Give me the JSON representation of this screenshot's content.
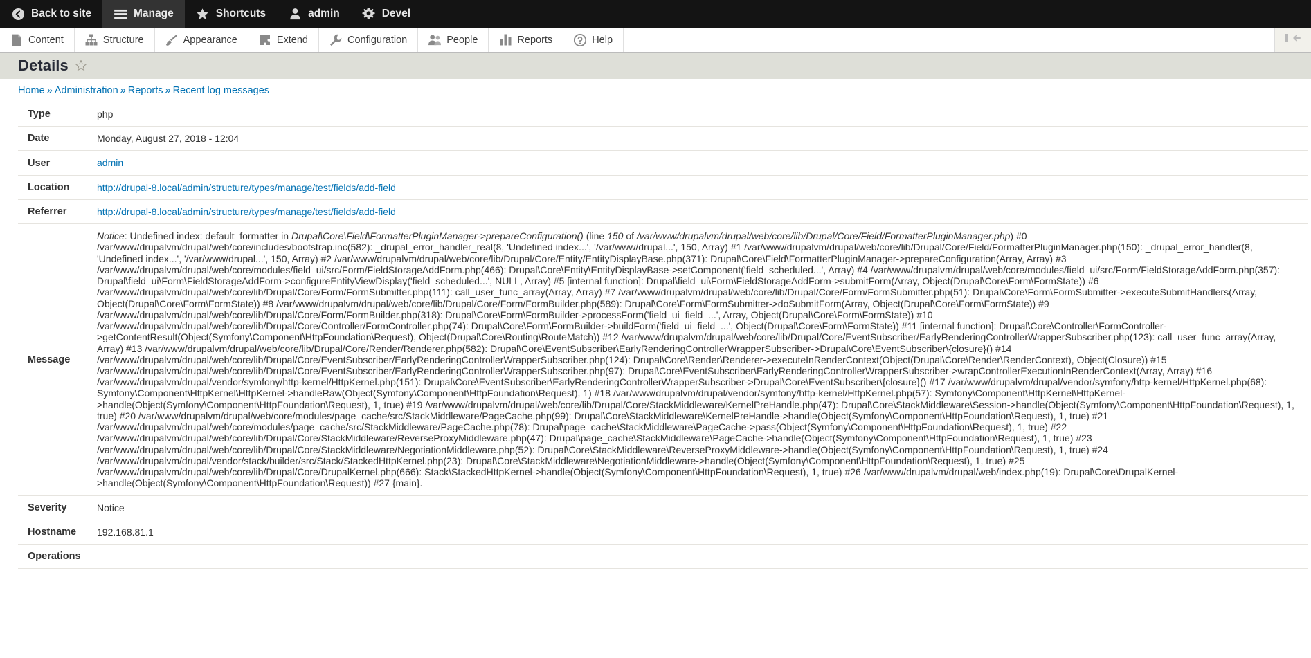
{
  "toolbar": {
    "items": [
      {
        "label": "Back to site",
        "icon": "back-arrow-icon",
        "active": false
      },
      {
        "label": "Manage",
        "icon": "hamburger-icon",
        "active": true
      },
      {
        "label": "Shortcuts",
        "icon": "star-icon",
        "active": false
      },
      {
        "label": "admin",
        "icon": "user-icon",
        "active": false
      },
      {
        "label": "Devel",
        "icon": "gear-icon",
        "active": false
      }
    ]
  },
  "admin_menu": {
    "items": [
      {
        "label": "Content",
        "icon": "file-icon"
      },
      {
        "label": "Structure",
        "icon": "sitemap-icon"
      },
      {
        "label": "Appearance",
        "icon": "paintbrush-icon"
      },
      {
        "label": "Extend",
        "icon": "puzzle-icon"
      },
      {
        "label": "Configuration",
        "icon": "wrench-icon"
      },
      {
        "label": "People",
        "icon": "people-icon"
      },
      {
        "label": "Reports",
        "icon": "bar-chart-icon"
      },
      {
        "label": "Help",
        "icon": "question-circle-icon"
      }
    ],
    "orientation_toggle_icon": "vertical-orientation-toggle-icon"
  },
  "page": {
    "title": "Details",
    "shortcut_star_icon": "star-outline-icon"
  },
  "breadcrumb": {
    "separator": "»",
    "items": [
      "Home",
      "Administration",
      "Reports",
      "Recent log messages"
    ]
  },
  "details": {
    "rows": [
      {
        "label": "Type",
        "value": "php",
        "link": false
      },
      {
        "label": "Date",
        "value": "Monday, August 27, 2018 - 12:04",
        "link": false
      },
      {
        "label": "User",
        "value": "admin",
        "link": true
      },
      {
        "label": "Location",
        "value": "http://drupal-8.local/admin/structure/types/manage/test/fields/add-field",
        "link": true
      },
      {
        "label": "Referrer",
        "value": "http://drupal-8.local/admin/structure/types/manage/test/fields/add-field",
        "link": true
      }
    ],
    "message_label": "Message",
    "message_html": "<em>Notice</em>: Undefined index: default_formatter in <em>Drupal\\Core\\Field\\FormatterPluginManager-&gt;prepareConfiguration()</em> (line <em>150</em> of <em>/var/www/drupalvm/drupal/web/core/lib/Drupal/Core/Field/FormatterPluginManager.php</em>) #0 /var/www/drupalvm/drupal/web/core/includes/bootstrap.inc(582): _drupal_error_handler_real(8, 'Undefined index...', '/var/www/drupal...', 150, Array) #1 /var/www/drupalvm/drupal/web/core/lib/Drupal/Core/Field/FormatterPluginManager.php(150): _drupal_error_handler(8, 'Undefined index...', '/var/www/drupal...', 150, Array) #2 /var/www/drupalvm/drupal/web/core/lib/Drupal/Core/Entity/EntityDisplayBase.php(371): Drupal\\Core\\Field\\FormatterPluginManager-&gt;prepareConfiguration(Array, Array) #3 /var/www/drupalvm/drupal/web/core/modules/field_ui/src/Form/FieldStorageAddForm.php(466): Drupal\\Core\\Entity\\EntityDisplayBase-&gt;setComponent('field_scheduled...', Array) #4 /var/www/drupalvm/drupal/web/core/modules/field_ui/src/Form/FieldStorageAddForm.php(357): Drupal\\field_ui\\Form\\FieldStorageAddForm-&gt;configureEntityViewDisplay('field_scheduled...', NULL, Array) #5 [internal function]: Drupal\\field_ui\\Form\\FieldStorageAddForm-&gt;submitForm(Array, Object(Drupal\\Core\\Form\\FormState)) #6 /var/www/drupalvm/drupal/web/core/lib/Drupal/Core/Form/FormSubmitter.php(111): call_user_func_array(Array, Array) #7 /var/www/drupalvm/drupal/web/core/lib/Drupal/Core/Form/FormSubmitter.php(51): Drupal\\Core\\Form\\FormSubmitter-&gt;executeSubmitHandlers(Array, Object(Drupal\\Core\\Form\\FormState)) #8 /var/www/drupalvm/drupal/web/core/lib/Drupal/Core/Form/FormBuilder.php(589): Drupal\\Core\\Form\\FormSubmitter-&gt;doSubmitForm(Array, Object(Drupal\\Core\\Form\\FormState)) #9 /var/www/drupalvm/drupal/web/core/lib/Drupal/Core/Form/FormBuilder.php(318): Drupal\\Core\\Form\\FormBuilder-&gt;processForm('field_ui_field_...', Array, Object(Drupal\\Core\\Form\\FormState)) #10 /var/www/drupalvm/drupal/web/core/lib/Drupal/Core/Controller/FormController.php(74): Drupal\\Core\\Form\\FormBuilder-&gt;buildForm('field_ui_field_...', Object(Drupal\\Core\\Form\\FormState)) #11 [internal function]: Drupal\\Core\\Controller\\FormController-&gt;getContentResult(Object(Symfony\\Component\\HttpFoundation\\Request), Object(Drupal\\Core\\Routing\\RouteMatch)) #12 /var/www/drupalvm/drupal/web/core/lib/Drupal/Core/EventSubscriber/EarlyRenderingControllerWrapperSubscriber.php(123): call_user_func_array(Array, Array) #13 /var/www/drupalvm/drupal/web/core/lib/Drupal/Core/Render/Renderer.php(582): Drupal\\Core\\EventSubscriber\\EarlyRenderingControllerWrapperSubscriber-&gt;Drupal\\Core\\EventSubscriber\\{closure}() #14 /var/www/drupalvm/drupal/web/core/lib/Drupal/Core/EventSubscriber/EarlyRenderingControllerWrapperSubscriber.php(124): Drupal\\Core\\Render\\Renderer-&gt;executeInRenderContext(Object(Drupal\\Core\\Render\\RenderContext), Object(Closure)) #15 /var/www/drupalvm/drupal/web/core/lib/Drupal/Core/EventSubscriber/EarlyRenderingControllerWrapperSubscriber.php(97): Drupal\\Core\\EventSubscriber\\EarlyRenderingControllerWrapperSubscriber-&gt;wrapControllerExecutionInRenderContext(Array, Array) #16 /var/www/drupalvm/drupal/vendor/symfony/http-kernel/HttpKernel.php(151): Drupal\\Core\\EventSubscriber\\EarlyRenderingControllerWrapperSubscriber-&gt;Drupal\\Core\\EventSubscriber\\{closure}() #17 /var/www/drupalvm/drupal/vendor/symfony/http-kernel/HttpKernel.php(68): Symfony\\Component\\HttpKernel\\HttpKernel-&gt;handleRaw(Object(Symfony\\Component\\HttpFoundation\\Request), 1) #18 /var/www/drupalvm/drupal/vendor/symfony/http-kernel/HttpKernel.php(57): Symfony\\Component\\HttpKernel\\HttpKernel-&gt;handle(Object(Symfony\\Component\\HttpFoundation\\Request), 1, true) #19 /var/www/drupalvm/drupal/web/core/lib/Drupal/Core/StackMiddleware/KernelPreHandle.php(47): Drupal\\Core\\StackMiddleware\\Session-&gt;handle(Object(Symfony\\Component\\HttpFoundation\\Request), 1, true) #20 /var/www/drupalvm/drupal/web/core/modules/page_cache/src/StackMiddleware/PageCache.php(99): Drupal\\Core\\StackMiddleware\\KernelPreHandle-&gt;handle(Object(Symfony\\Component\\HttpFoundation\\Request), 1, true) #21 /var/www/drupalvm/drupal/web/core/modules/page_cache/src/StackMiddleware/PageCache.php(78): Drupal\\page_cache\\StackMiddleware\\PageCache-&gt;pass(Object(Symfony\\Component\\HttpFoundation\\Request), 1, true) #22 /var/www/drupalvm/drupal/web/core/lib/Drupal/Core/StackMiddleware/ReverseProxyMiddleware.php(47): Drupal\\page_cache\\StackMiddleware\\PageCache-&gt;handle(Object(Symfony\\Component\\HttpFoundation\\Request), 1, true) #23 /var/www/drupalvm/drupal/web/core/lib/Drupal/Core/StackMiddleware/NegotiationMiddleware.php(52): Drupal\\Core\\StackMiddleware\\ReverseProxyMiddleware-&gt;handle(Object(Symfony\\Component\\HttpFoundation\\Request), 1, true) #24 /var/www/drupalvm/drupal/vendor/stack/builder/src/Stack/StackedHttpKernel.php(23): Drupal\\Core\\StackMiddleware\\NegotiationMiddleware-&gt;handle(Object(Symfony\\Component\\HttpFoundation\\Request), 1, true) #25 /var/www/drupalvm/drupal/web/core/lib/Drupal/Core/DrupalKernel.php(666): Stack\\StackedHttpKernel-&gt;handle(Object(Symfony\\Component\\HttpFoundation\\Request), 1, true) #26 /var/www/drupalvm/drupal/web/index.php(19): Drupal\\Core\\DrupalKernel-&gt;handle(Object(Symfony\\Component\\HttpFoundation\\Request)) #27 {main}.",
    "rows_after": [
      {
        "label": "Severity",
        "value": "Notice",
        "link": false
      },
      {
        "label": "Hostname",
        "value": "192.168.81.1",
        "link": false
      },
      {
        "label": "Operations",
        "value": "",
        "link": false
      }
    ]
  },
  "colors": {
    "toolbar_bg": "#141414",
    "toolbar_active_bg": "#333333",
    "title_band_bg": "#dedfd8",
    "link": "#0071b3",
    "menu_bg": "#ffffff"
  }
}
